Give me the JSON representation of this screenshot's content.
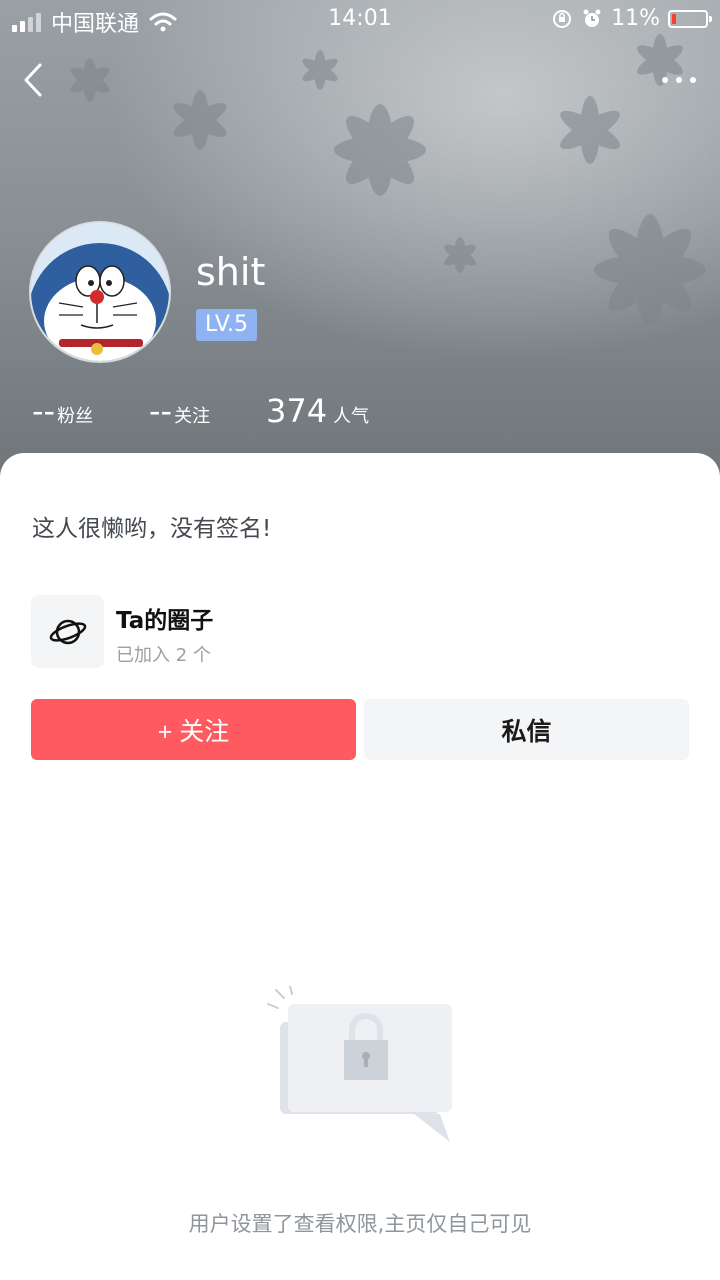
{
  "status_bar": {
    "carrier": "中国联通",
    "time": "14:01",
    "battery": "11%",
    "battery_level": 0.11
  },
  "nav": {
    "back_icon": "chevron-left-icon",
    "more_icon": "more-dots-icon"
  },
  "profile": {
    "username": "shit",
    "level": "LV.5",
    "avatar": "doraemon-avatar"
  },
  "stats": [
    {
      "value": "--",
      "label": "粉丝"
    },
    {
      "value": "--",
      "label": "关注"
    },
    {
      "value": "374",
      "label": "人气"
    }
  ],
  "signature": "这人很懒哟，没有签名!",
  "circle": {
    "icon": "planet-icon",
    "title": "Ta的圈子",
    "subtitle": "已加入 2 个"
  },
  "actions": {
    "follow": "+ 关注",
    "message": "私信"
  },
  "empty_state": {
    "icon": "lock-icon",
    "message": "用户设置了查看权限,主页仅自己可见"
  },
  "colors": {
    "follow_button": "#ff5a5f",
    "level_badge": "#8fb3f2",
    "message_button": "#f4f5f7"
  }
}
